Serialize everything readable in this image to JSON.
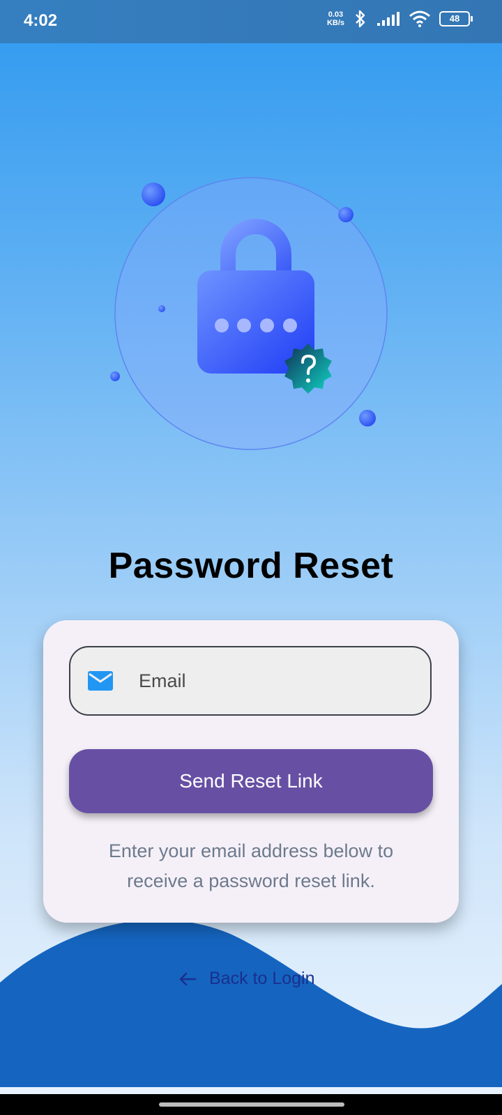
{
  "status_bar": {
    "time": "4:02",
    "net_speed_value": "0.03",
    "net_speed_unit": "KB/s",
    "battery_level": "48",
    "icons": [
      "bluetooth-icon",
      "signal-icon",
      "wifi-icon",
      "battery-icon"
    ]
  },
  "illustration": {
    "icons": [
      "padlock-icon",
      "question-badge-icon"
    ]
  },
  "page": {
    "title": "Password Reset"
  },
  "form": {
    "email_placeholder": "Email",
    "email_icon": "mail-icon",
    "send_button_label": "Send Reset Link",
    "helper_line1": "Enter your email address below to",
    "helper_line2": "receive a password reset link."
  },
  "footer": {
    "back_link_label": "Back to Login",
    "back_icon": "arrow-left-icon"
  },
  "colors": {
    "primary_button": "#6750a4",
    "wave": "#1565c0",
    "status_bar": "#357fc0",
    "mail_icon": "#2196f3",
    "back_link": "#1a2f8f"
  }
}
